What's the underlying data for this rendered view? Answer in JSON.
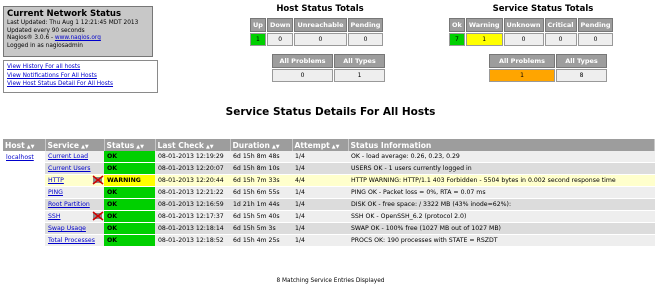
{
  "status_box": {
    "title": "Current Network Status",
    "last_updated": "Last Updated: Thu Aug 1 12:21:45 MDT 2013",
    "updated_every": "Updated every 90 seconds",
    "version_prefix": "Nagios® 3.0.6 - ",
    "version_link": "www.nagios.org",
    "logged_in": "Logged in as nagiosadmin"
  },
  "nav_links": [
    "View History For all hosts",
    "View Notifications For All Hosts",
    "View Host Status Detail For All Hosts"
  ],
  "host_totals": {
    "title": "Host Status Totals",
    "headers": [
      "Up",
      "Down",
      "Unreachable",
      "Pending"
    ],
    "values": [
      "1",
      "0",
      "0",
      "0"
    ],
    "summary_headers": [
      "All Problems",
      "All Types"
    ],
    "summary_values": [
      "0",
      "1"
    ]
  },
  "service_totals": {
    "title": "Service Status Totals",
    "headers": [
      "Ok",
      "Warning",
      "Unknown",
      "Critical",
      "Pending"
    ],
    "values": [
      "7",
      "1",
      "0",
      "0",
      "0"
    ],
    "summary_headers": [
      "All Problems",
      "All Types"
    ],
    "summary_values": [
      "1",
      "8"
    ]
  },
  "main_title": "Service Status Details For All Hosts",
  "table": {
    "headers": [
      "Host",
      "Service",
      "Status",
      "Last Check",
      "Duration",
      "Attempt",
      "Status Information"
    ],
    "host": "localhost",
    "rows": [
      {
        "service": "Current Load",
        "status": "OK",
        "last_check": "08-01-2013 12:19:29",
        "duration": "6d 15h 8m 48s",
        "attempt": "1/4",
        "info": "OK - load average: 0.26, 0.23, 0.29"
      },
      {
        "service": "Current Users",
        "status": "OK",
        "last_check": "08-01-2013 12:20:07",
        "duration": "6d 15h 8m 10s",
        "attempt": "1/4",
        "info": "USERS OK - 1 users currently logged in"
      },
      {
        "service": "HTTP",
        "status": "WARNING",
        "last_check": "08-01-2013 12:20:44",
        "duration": "6d 15h 7m 33s",
        "attempt": "4/4",
        "info": "HTTP WARNING: HTTP/1.1 403 Forbidden - 5504 bytes in 0.002 second response time"
      },
      {
        "service": "PING",
        "status": "OK",
        "last_check": "08-01-2013 12:21:22",
        "duration": "6d 15h 6m 55s",
        "attempt": "1/4",
        "info": "PING OK - Packet loss = 0%, RTA = 0.07 ms"
      },
      {
        "service": "Root Partition",
        "status": "OK",
        "last_check": "08-01-2013 12:16:59",
        "duration": "1d 21h 1m 44s",
        "attempt": "1/4",
        "info": "DISK OK - free space: / 3322 MB (43% inode=62%):"
      },
      {
        "service": "SSH",
        "status": "OK",
        "last_check": "08-01-2013 12:17:37",
        "duration": "6d 15h 5m 40s",
        "attempt": "1/4",
        "info": "SSH OK - OpenSSH_6.2 (protocol 2.0)"
      },
      {
        "service": "Swap Usage",
        "status": "OK",
        "last_check": "08-01-2013 12:18:14",
        "duration": "6d 15h 5m 3s",
        "attempt": "1/4",
        "info": "SWAP OK - 100% free (1027 MB out of 1027 MB)"
      },
      {
        "service": "Total Processes",
        "status": "OK",
        "last_check": "08-01-2013 12:18:52",
        "duration": "6d 15h 4m 25s",
        "attempt": "1/4",
        "info": "PROCS OK: 190 processes with STATE = RSZDT"
      }
    ]
  },
  "footer": "8 Matching Service Entries Displayed",
  "colors": {
    "ok": "#00d000",
    "warning": "#ffff00",
    "problem": "#ffa500",
    "header": "#9d9d9d"
  },
  "icons": {
    "sort": "sort-arrows-icon",
    "notifications_disabled": "notifications-disabled-icon"
  }
}
